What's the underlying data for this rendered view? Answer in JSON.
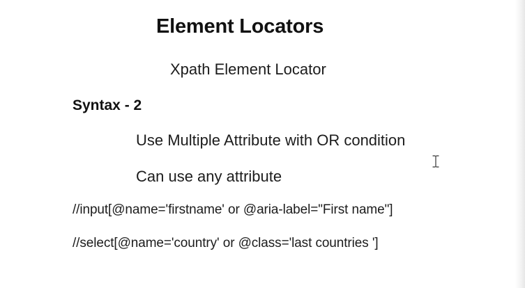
{
  "slide": {
    "title": "Element Locators",
    "subtitle": "Xpath Element Locator",
    "section_heading": "Syntax - 2",
    "points": [
      "Use Multiple Attribute with OR condition",
      "Can use any attribute"
    ],
    "examples": [
      "//input[@name='firstname'  or  @aria-label=\"First name\"]",
      "//select[@name='country' or @class='last countries ']"
    ]
  },
  "cursor": {
    "icon": "text-cursor-icon"
  }
}
